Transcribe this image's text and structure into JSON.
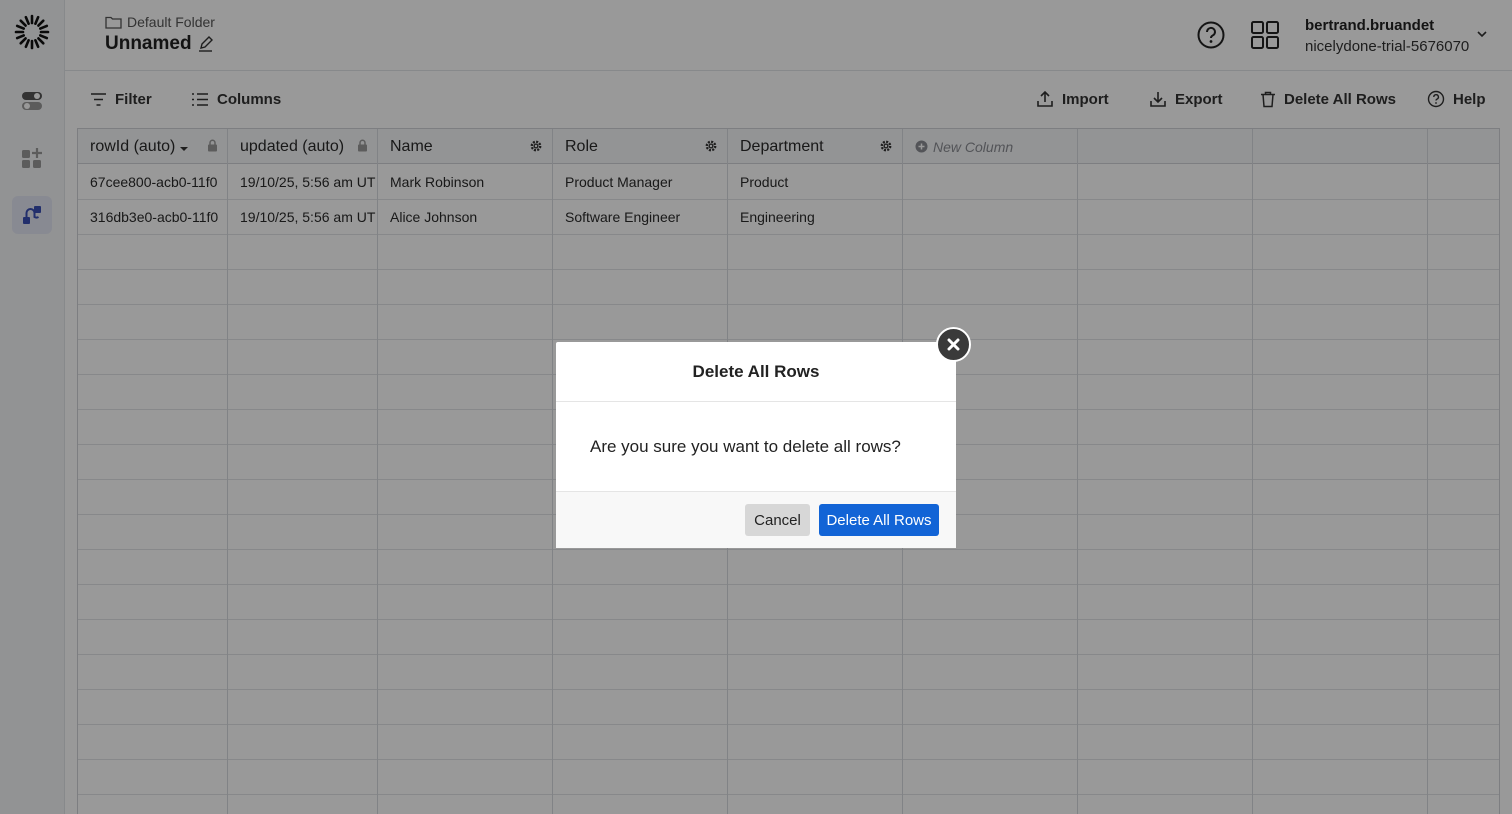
{
  "breadcrumb": {
    "folder": "Default Folder"
  },
  "page": {
    "title": "Unnamed"
  },
  "user": {
    "name": "bertrand.bruandet",
    "org": "nicelydone-trial-5676070"
  },
  "toolbar": {
    "filter": "Filter",
    "columns": "Columns",
    "import": "Import",
    "export": "Export",
    "delete_all": "Delete All Rows",
    "help": "Help"
  },
  "table": {
    "columns": [
      "rowId (auto)",
      "updated (auto)",
      "Name",
      "Role",
      "Department"
    ],
    "new_column": "New Column",
    "rows": [
      [
        "67cee800-acb0-11f0",
        "19/10/25, 5:56 am UT",
        "Mark Robinson",
        "Product Manager",
        "Product"
      ],
      [
        "316db3e0-acb0-11f0",
        "19/10/25, 5:56 am UT",
        "Alice Johnson",
        "Software Engineer",
        "Engineering"
      ]
    ]
  },
  "modal": {
    "title": "Delete All Rows",
    "message": "Are you sure you want to delete all rows?",
    "cancel": "Cancel",
    "confirm": "Delete All Rows"
  },
  "colors": {
    "primary": "#1264d6",
    "sidebar_accent": "#3a4fb5"
  },
  "icons": [
    "logo-icon",
    "toggle-icon",
    "add-widget-icon",
    "flow-icon",
    "folder-icon",
    "edit-icon",
    "help-circle-icon",
    "apps-grid-icon",
    "chevron-down-icon",
    "filter-icon",
    "columns-icon",
    "upload-icon",
    "download-icon",
    "trash-icon",
    "lock-icon",
    "gear-icon",
    "plus-circle-icon",
    "close-icon"
  ]
}
